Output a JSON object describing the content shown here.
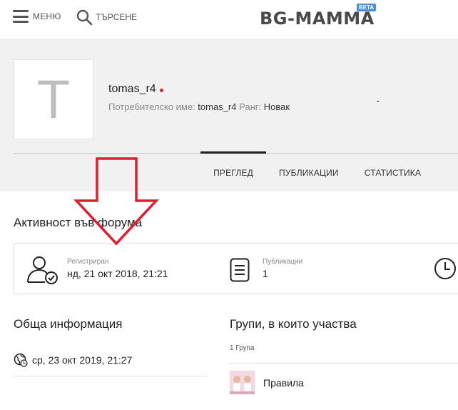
{
  "header": {
    "menu_label": "МЕНЮ",
    "search_label": "ТЪРСЕНЕ",
    "logo_text": "BG-MAMMA",
    "logo_badge": "BETA"
  },
  "profile": {
    "avatar_letter": "T",
    "username": "tomas_r4",
    "username_label": "Потребителско име:",
    "username_value": "tomas_r4",
    "rank_label": "Ранг:",
    "rank_value": "Новак",
    "tabs": [
      {
        "label": "ПРЕГЛЕД",
        "active": true
      },
      {
        "label": "ПУБЛИКАЦИИ",
        "active": false
      },
      {
        "label": "СТАТИСТИКА",
        "active": false
      }
    ]
  },
  "activity": {
    "title": "Активност във форума",
    "stats": [
      {
        "label": "Регистриран",
        "value": "нд, 21 окт 2018, 21:21",
        "icon": "user-check-icon"
      },
      {
        "label": "Публикации",
        "value": "1",
        "icon": "document-icon"
      },
      {
        "label": "",
        "value": "",
        "icon": "clock-icon"
      }
    ]
  },
  "general": {
    "title": "Обща информация",
    "last_seen": "ср, 23 окт 2019, 21:27"
  },
  "groups": {
    "title": "Групи, в които участва",
    "count_label": "1 Група",
    "items": [
      {
        "name": "Правила"
      }
    ]
  },
  "colors": {
    "online_dot": "#e0202e",
    "annotation_arrow": "#e0202e",
    "profile_bg": "#f1f1f1",
    "logo_badge": "#4a90d9"
  }
}
